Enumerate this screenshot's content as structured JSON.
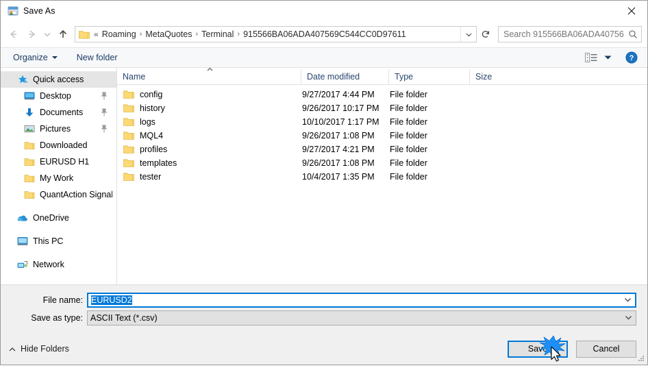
{
  "window": {
    "title": "Save As",
    "icon": "save-as-icon",
    "close_label": "✕"
  },
  "navbar": {
    "back_icon": "back-arrow-icon",
    "forward_icon": "forward-arrow-icon",
    "recent_icon": "recent-locations-chevron-icon",
    "up_icon": "up-arrow-icon",
    "folder_icon": "folder-icon",
    "overflow": "«",
    "breadcrumbs": [
      "Roaming",
      "MetaQuotes",
      "Terminal",
      "915566BA06ADA407569C544CC0D97611"
    ],
    "separator": "›",
    "dropdown_icon": "chevron-down-icon",
    "refresh_icon": "refresh-icon"
  },
  "search": {
    "placeholder": "Search 915566BA06ADA40756…",
    "icon": "search-icon"
  },
  "toolbar": {
    "organize_label": "Organize",
    "new_folder_label": "New folder",
    "view_icon": "view-layout-icon",
    "view_caret_icon": "chevron-down-icon",
    "help_icon": "help-icon"
  },
  "sidebar": {
    "items": [
      {
        "label": "Quick access",
        "icon": "star-pin-icon",
        "selected": true,
        "indent": false,
        "pinned": false
      },
      {
        "label": "Desktop",
        "icon": "desktop-icon",
        "selected": false,
        "indent": true,
        "pinned": true
      },
      {
        "label": "Documents",
        "icon": "documents-download-icon",
        "selected": false,
        "indent": true,
        "pinned": true
      },
      {
        "label": "Pictures",
        "icon": "pictures-icon",
        "selected": false,
        "indent": true,
        "pinned": true
      },
      {
        "label": "Downloaded",
        "icon": "folder-icon",
        "selected": false,
        "indent": true,
        "pinned": false
      },
      {
        "label": "EURUSD H1",
        "icon": "folder-icon",
        "selected": false,
        "indent": true,
        "pinned": false
      },
      {
        "label": "My Work",
        "icon": "folder-icon",
        "selected": false,
        "indent": true,
        "pinned": false
      },
      {
        "label": "QuantAction Signal",
        "icon": "folder-icon",
        "selected": false,
        "indent": true,
        "pinned": false
      },
      {
        "label": "OneDrive",
        "icon": "onedrive-cloud-icon",
        "selected": false,
        "indent": false,
        "pinned": false,
        "gap_before": true
      },
      {
        "label": "This PC",
        "icon": "this-pc-icon",
        "selected": false,
        "indent": false,
        "pinned": false,
        "gap_before": true
      },
      {
        "label": "Network",
        "icon": "network-icon",
        "selected": false,
        "indent": false,
        "pinned": false,
        "gap_before": true
      }
    ]
  },
  "filelist": {
    "columns": [
      "Name",
      "Date modified",
      "Type",
      "Size"
    ],
    "sort_column": "Name",
    "sort_direction": "ascending",
    "rows": [
      {
        "name": "config",
        "date": "9/27/2017 4:44 PM",
        "type": "File folder",
        "size": ""
      },
      {
        "name": "history",
        "date": "9/26/2017 10:17 PM",
        "type": "File folder",
        "size": ""
      },
      {
        "name": "logs",
        "date": "10/10/2017 1:17 PM",
        "type": "File folder",
        "size": ""
      },
      {
        "name": "MQL4",
        "date": "9/26/2017 1:08 PM",
        "type": "File folder",
        "size": ""
      },
      {
        "name": "profiles",
        "date": "9/27/2017 4:21 PM",
        "type": "File folder",
        "size": ""
      },
      {
        "name": "templates",
        "date": "9/26/2017 1:08 PM",
        "type": "File folder",
        "size": ""
      },
      {
        "name": "tester",
        "date": "10/4/2017 1:35 PM",
        "type": "File folder",
        "size": ""
      }
    ]
  },
  "form": {
    "filename_label": "File name:",
    "filename_value": "EURUSD2",
    "filetype_label": "Save as type:",
    "filetype_value": "ASCII Text (*.csv)",
    "dropdown_icon": "chevron-down-icon"
  },
  "footer": {
    "hide_folders_label": "Hide Folders",
    "hide_folders_icon": "chevron-up-icon",
    "save_label": "Save",
    "cancel_label": "Cancel",
    "resize_grip": "resize-grip-icon",
    "click_indicator": "click-burst-icon",
    "cursor": "mouse-pointer-icon"
  },
  "colors": {
    "accent": "#0078d7",
    "folder_yellow": "#fcd975",
    "header_text": "#28456c",
    "toolbar_bg": "#f7f8fa",
    "footer_bg": "#f0f0f0",
    "selection_bg": "#e5e5e5"
  }
}
